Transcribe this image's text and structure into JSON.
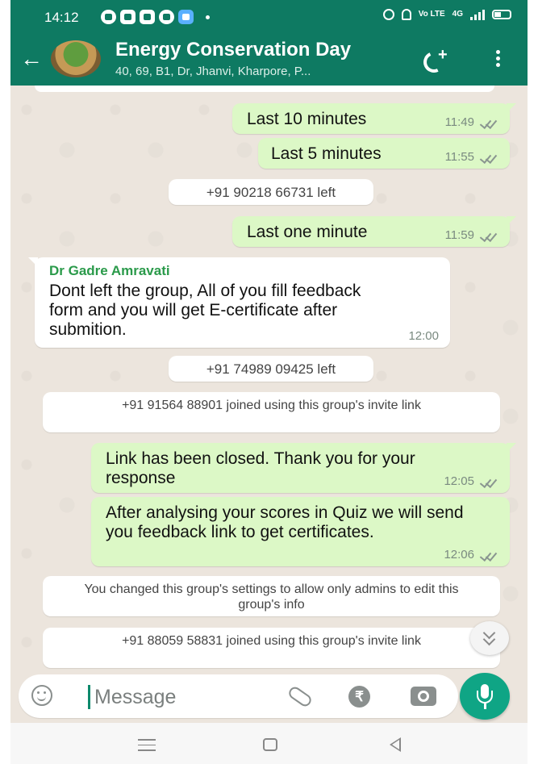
{
  "status_bar": {
    "time": "14:12",
    "network_label": "4G",
    "lte_label": "Vo LTE"
  },
  "header": {
    "title": "Energy Conservation Day",
    "subtitle": "40, 69, B1, Dr, Jhanvi, Kharpore, P...",
    "icons": [
      "back-arrow-icon",
      "group-avatar",
      "add-call-icon",
      "more-vert-icon"
    ]
  },
  "messages": [
    {
      "kind": "out",
      "text": "Last 10 minutes",
      "time": "11:49"
    },
    {
      "kind": "out",
      "text": "Last 5 minutes",
      "time": "11:55"
    },
    {
      "kind": "system",
      "text": "+91 90218 66731 left"
    },
    {
      "kind": "out",
      "text": "Last one minute",
      "time": "11:59"
    },
    {
      "kind": "in",
      "sender": "Dr Gadre Amravati",
      "text": "Dont left the group, All of you fill feedback form and you will get E-certificate after submition.",
      "time": "12:00"
    },
    {
      "kind": "system",
      "text": "+91 74989 09425 left"
    },
    {
      "kind": "system",
      "text": "+91 91564 88901 joined using this group's invite link"
    },
    {
      "kind": "out",
      "text": "Link has been closed. Thank you for your response",
      "time": "12:05"
    },
    {
      "kind": "out",
      "text": "After analysing your scores in Quiz we will send you feedback link to get certificates.",
      "time": "12:06"
    },
    {
      "kind": "system",
      "text": "You changed this group's settings to allow only admins to edit this group's info"
    },
    {
      "kind": "system",
      "text": "+91 88059 58831 joined using this group's invite link"
    }
  ],
  "composer": {
    "placeholder": "Message",
    "icons": [
      "emoji-icon",
      "attach-icon",
      "rupee-payment-icon",
      "camera-icon",
      "mic-icon"
    ]
  },
  "colors": {
    "header": "#0e7a62",
    "outgoing_bubble": "#dcf8c6",
    "incoming_bubble": "#ffffff",
    "chat_background": "#ece5dd",
    "sender_name": "#2a9a4a",
    "mic_button": "#0fa585"
  }
}
